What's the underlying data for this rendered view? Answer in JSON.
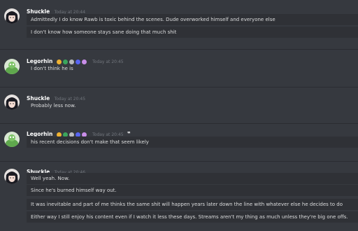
{
  "messages": [
    {
      "author": "Shuckle",
      "timestamp": "Today at 20:44",
      "lines": [
        "Admittedly I do know Rawb is toxic behind the scenes. Dude overworked himself and everyone else",
        "I don't know how someone stays sane doing that much shit"
      ]
    },
    {
      "author": "Legorhin",
      "timestamp": "Today at 20:45",
      "lines": [
        "I don't think he is"
      ]
    },
    {
      "author": "Shuckle",
      "timestamp": "Today at 20:45",
      "lines": [
        "Probably less now."
      ]
    },
    {
      "author": "Legorhin",
      "timestamp": "Today at 20:45",
      "lines": [
        "his recent decisions don't make that seem likely"
      ]
    },
    {
      "author": "Shuckle",
      "timestamp": "Today at 20:46",
      "lines": [
        "Well yeah. Now.",
        "Since he's burned himself way out.",
        "It was inevitable and part of me thinks the same shit will happen years later down the line with whatever else he decides to do",
        "Either way I still enjoy his content even if  I watch it less these days. Streams aren't my thing as much unless they're big one offs."
      ]
    }
  ],
  "colors": {
    "background": "#36393f",
    "line_bg": "#2f3136",
    "username": "#ffffff",
    "timestamp": "#72767d"
  },
  "icons": {
    "legorhin_badges": [
      "crown-badge-icon",
      "gem-badge-icon",
      "controller-badge-icon",
      "star-badge-icon",
      "purple-badge-icon"
    ],
    "quote_icon": "quote-icon"
  }
}
